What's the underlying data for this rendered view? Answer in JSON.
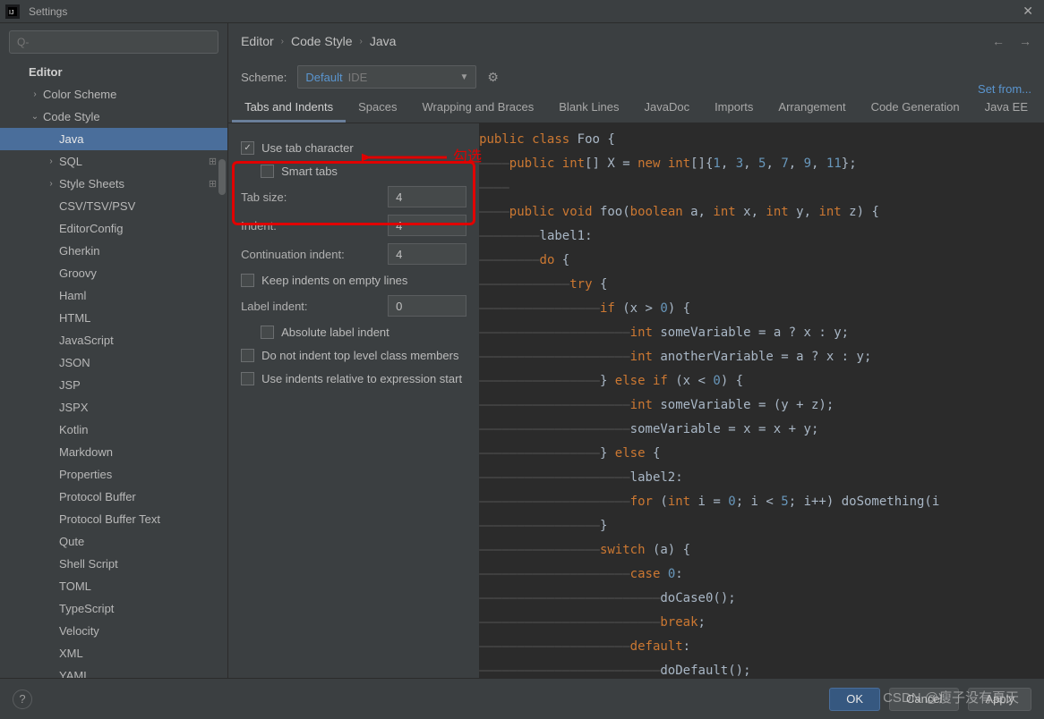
{
  "window": {
    "title": "Settings"
  },
  "sidebar": {
    "search_placeholder": "Q-",
    "tree": [
      {
        "label": "Editor",
        "level": 0,
        "arrow": "",
        "bold": true
      },
      {
        "label": "Color Scheme",
        "level": 1,
        "arrow": "›"
      },
      {
        "label": "Code Style",
        "level": 1,
        "arrow": "⌄"
      },
      {
        "label": "Java",
        "level": 2,
        "arrow": "",
        "selected": true
      },
      {
        "label": "SQL",
        "level": 2,
        "arrow": "›",
        "gear": true
      },
      {
        "label": "Style Sheets",
        "level": 2,
        "arrow": "›",
        "gear": true
      },
      {
        "label": "CSV/TSV/PSV",
        "level": 3
      },
      {
        "label": "EditorConfig",
        "level": 3
      },
      {
        "label": "Gherkin",
        "level": 3
      },
      {
        "label": "Groovy",
        "level": 3
      },
      {
        "label": "Haml",
        "level": 3
      },
      {
        "label": "HTML",
        "level": 3
      },
      {
        "label": "JavaScript",
        "level": 3
      },
      {
        "label": "JSON",
        "level": 3
      },
      {
        "label": "JSP",
        "level": 3
      },
      {
        "label": "JSPX",
        "level": 3
      },
      {
        "label": "Kotlin",
        "level": 3
      },
      {
        "label": "Markdown",
        "level": 3
      },
      {
        "label": "Properties",
        "level": 3
      },
      {
        "label": "Protocol Buffer",
        "level": 3
      },
      {
        "label": "Protocol Buffer Text",
        "level": 3
      },
      {
        "label": "Qute",
        "level": 3
      },
      {
        "label": "Shell Script",
        "level": 3
      },
      {
        "label": "TOML",
        "level": 3
      },
      {
        "label": "TypeScript",
        "level": 3
      },
      {
        "label": "Velocity",
        "level": 3
      },
      {
        "label": "XML",
        "level": 3
      },
      {
        "label": "YAML",
        "level": 3
      }
    ]
  },
  "breadcrumb": {
    "parts": [
      "Editor",
      "Code Style",
      "Java"
    ]
  },
  "scheme": {
    "label": "Scheme:",
    "value": "Default",
    "suffix": "IDE",
    "set_from": "Set from..."
  },
  "tabs": [
    "Tabs and Indents",
    "Spaces",
    "Wrapping and Braces",
    "Blank Lines",
    "JavaDoc",
    "Imports",
    "Arrangement",
    "Code Generation",
    "Java EE"
  ],
  "active_tab": "Tabs and Indents",
  "form": {
    "use_tab_character": {
      "label": "Use tab character",
      "checked": true
    },
    "smart_tabs": {
      "label": "Smart tabs",
      "checked": false
    },
    "tab_size": {
      "label": "Tab size:",
      "value": "4"
    },
    "indent": {
      "label": "Indent:",
      "value": "4"
    },
    "continuation_indent": {
      "label": "Continuation indent:",
      "value": "4"
    },
    "keep_indents": {
      "label": "Keep indents on empty lines",
      "checked": false
    },
    "label_indent": {
      "label": "Label indent:",
      "value": "0"
    },
    "absolute_label_indent": {
      "label": "Absolute label indent",
      "checked": false
    },
    "do_not_indent_top": {
      "label": "Do not indent top level class members",
      "checked": false
    },
    "use_indents_relative": {
      "label": "Use indents relative to expression start",
      "checked": false
    }
  },
  "annotation": {
    "text": "勾选"
  },
  "code_lines": [
    {
      "g": 0,
      "tokens": [
        [
          "kw",
          "public class"
        ],
        [
          "ident",
          " Foo "
        ],
        [
          "br",
          "{"
        ]
      ]
    },
    {
      "g": 1,
      "tokens": [
        [
          "kw",
          "public int"
        ],
        [
          "br",
          "[] "
        ],
        [
          "ident",
          "X "
        ],
        [
          "br",
          "= "
        ],
        [
          "kw",
          "new int"
        ],
        [
          "br",
          "[]{"
        ],
        [
          "num",
          "1"
        ],
        [
          "br",
          ", "
        ],
        [
          "num",
          "3"
        ],
        [
          "br",
          ", "
        ],
        [
          "num",
          "5"
        ],
        [
          "br",
          ", "
        ],
        [
          "num",
          "7"
        ],
        [
          "br",
          ", "
        ],
        [
          "num",
          "9"
        ],
        [
          "br",
          ", "
        ],
        [
          "num",
          "11"
        ],
        [
          "br",
          "};"
        ]
      ]
    },
    {
      "g": 1,
      "tokens": []
    },
    {
      "g": 1,
      "tokens": [
        [
          "kw",
          "public void"
        ],
        [
          "ident",
          " foo"
        ],
        [
          "br",
          "("
        ],
        [
          "kw",
          "boolean"
        ],
        [
          "ident",
          " a"
        ],
        [
          "br",
          ", "
        ],
        [
          "kw",
          "int"
        ],
        [
          "ident",
          " x"
        ],
        [
          "br",
          ", "
        ],
        [
          "kw",
          "int"
        ],
        [
          "ident",
          " y"
        ],
        [
          "br",
          ", "
        ],
        [
          "kw",
          "int"
        ],
        [
          "ident",
          " z"
        ],
        [
          "br",
          ") {"
        ]
      ]
    },
    {
      "g": 2,
      "tokens": [
        [
          "ident",
          "label1:"
        ]
      ]
    },
    {
      "g": 2,
      "tokens": [
        [
          "kw",
          "do"
        ],
        [
          "br",
          " {"
        ]
      ]
    },
    {
      "g": 3,
      "tokens": [
        [
          "kw",
          "try"
        ],
        [
          "br",
          " {"
        ]
      ]
    },
    {
      "g": 4,
      "tokens": [
        [
          "kw",
          "if"
        ],
        [
          "br",
          " (x > "
        ],
        [
          "num",
          "0"
        ],
        [
          "br",
          ") {"
        ]
      ]
    },
    {
      "g": 5,
      "tokens": [
        [
          "kw",
          "int"
        ],
        [
          "ident",
          " someVariable "
        ],
        [
          "br",
          "= a ? x : y;"
        ]
      ]
    },
    {
      "g": 5,
      "tokens": [
        [
          "kw",
          "int"
        ],
        [
          "ident",
          " anotherVariable "
        ],
        [
          "br",
          "= a ? x : y;"
        ]
      ]
    },
    {
      "g": 4,
      "tokens": [
        [
          "br",
          "} "
        ],
        [
          "kw",
          "else if"
        ],
        [
          "br",
          " (x < "
        ],
        [
          "num",
          "0"
        ],
        [
          "br",
          ") {"
        ]
      ]
    },
    {
      "g": 5,
      "tokens": [
        [
          "kw",
          "int"
        ],
        [
          "ident",
          " someVariable "
        ],
        [
          "br",
          "= (y + z);"
        ]
      ]
    },
    {
      "g": 5,
      "tokens": [
        [
          "ident",
          "someVariable "
        ],
        [
          "br",
          "= x = x + y;"
        ]
      ]
    },
    {
      "g": 4,
      "tokens": [
        [
          "br",
          "} "
        ],
        [
          "kw",
          "else"
        ],
        [
          "br",
          " {"
        ]
      ]
    },
    {
      "g": 5,
      "tokens": [
        [
          "ident",
          "label2:"
        ]
      ]
    },
    {
      "g": 5,
      "tokens": [
        [
          "kw",
          "for"
        ],
        [
          "br",
          " ("
        ],
        [
          "kw",
          "int"
        ],
        [
          "ident",
          " i "
        ],
        [
          "br",
          "= "
        ],
        [
          "num",
          "0"
        ],
        [
          "br",
          "; i < "
        ],
        [
          "num",
          "5"
        ],
        [
          "br",
          "; i++) doSomething(i"
        ]
      ]
    },
    {
      "g": 4,
      "tokens": [
        [
          "br",
          "}"
        ]
      ]
    },
    {
      "g": 4,
      "tokens": [
        [
          "kw",
          "switch"
        ],
        [
          "br",
          " (a) {"
        ]
      ]
    },
    {
      "g": 5,
      "tokens": [
        [
          "kw",
          "case"
        ],
        [
          "br",
          " "
        ],
        [
          "num",
          "0"
        ],
        [
          "br",
          ":"
        ]
      ]
    },
    {
      "g": 6,
      "tokens": [
        [
          "ident",
          "doCase0"
        ],
        [
          "br",
          "();"
        ]
      ]
    },
    {
      "g": 6,
      "tokens": [
        [
          "kw",
          "break"
        ],
        [
          "br",
          ";"
        ]
      ]
    },
    {
      "g": 5,
      "tokens": [
        [
          "kw",
          "default"
        ],
        [
          "br",
          ":"
        ]
      ]
    },
    {
      "g": 6,
      "tokens": [
        [
          "ident",
          "doDefault"
        ],
        [
          "br",
          "();"
        ]
      ]
    }
  ],
  "buttons": {
    "ok": "OK",
    "cancel": "Cancel",
    "apply": "Apply"
  },
  "watermark": "CSDN @瘦子没有夏天"
}
